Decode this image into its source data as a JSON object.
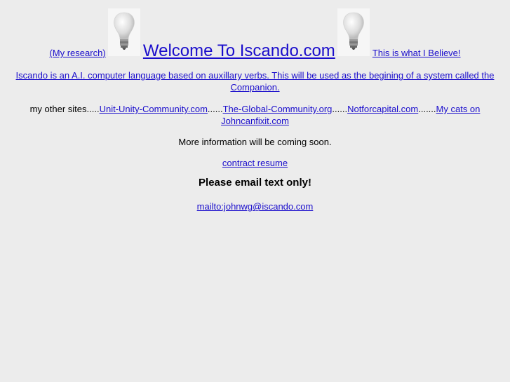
{
  "header": {
    "research_link": "(My research)",
    "title_link": "Welcome To Iscando.com",
    "believe_link": "This is what I Believe!",
    "left_icon": "lightbulb-icon",
    "right_icon": "lightbulb-icon"
  },
  "intro": {
    "text": "Iscando is an A.I. computer language based on auxillary verbs. This will be used as the begining of a system called the Companion."
  },
  "other_sites": {
    "prefix": "my other sites.....",
    "sites": [
      {
        "label": "Unit-Unity-Community.com",
        "sep": "......"
      },
      {
        "label": "The-Global-Community.org",
        "sep": "......"
      },
      {
        "label": "Notforcapital.com",
        "sep": "......."
      },
      {
        "label": "My cats on Johncanfixit.com",
        "sep": ""
      }
    ]
  },
  "info": {
    "coming_soon": "More information will be coming soon."
  },
  "resume": {
    "label": "contract resume"
  },
  "email": {
    "notice": "Please email text only!",
    "link": "mailto:johnwg@iscando.com"
  },
  "colors": {
    "background": "#ececec",
    "link": "#1a0dcc"
  }
}
